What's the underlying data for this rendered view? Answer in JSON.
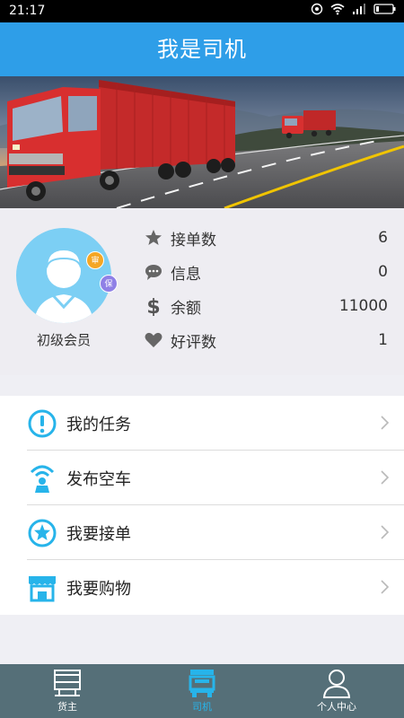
{
  "status_bar": {
    "time": "21:17"
  },
  "header": {
    "title": "我是司机"
  },
  "profile": {
    "member_level": "初级会员",
    "badges": [
      {
        "text": "审",
        "color": "#f5a623"
      },
      {
        "text": "保",
        "color": "#8f80e6"
      }
    ],
    "stats": [
      {
        "icon": "star-icon",
        "label": "接单数",
        "value": "6"
      },
      {
        "icon": "message-icon",
        "label": "信息",
        "value": "0"
      },
      {
        "icon": "dollar-icon",
        "label": "余额",
        "value": "11000"
      },
      {
        "icon": "heart-icon",
        "label": "好评数",
        "value": "1"
      }
    ]
  },
  "menu": [
    {
      "icon": "exclamation-icon",
      "label": "我的任务"
    },
    {
      "icon": "truck-signal-icon",
      "label": "发布空车"
    },
    {
      "icon": "star-circle-icon",
      "label": "我要接单"
    },
    {
      "icon": "shop-icon",
      "label": "我要购物"
    }
  ],
  "tabbar": {
    "tabs": [
      {
        "icon": "cargo-icon",
        "label": "货主",
        "active": false
      },
      {
        "icon": "truck-icon",
        "label": "司机",
        "active": true
      },
      {
        "icon": "person-icon",
        "label": "个人中心",
        "active": false
      }
    ]
  },
  "colors": {
    "header_bg": "#2e9ee8",
    "accent": "#27b4ea",
    "tabbar_bg": "#556f78",
    "avatar_bg": "#7ccff4"
  }
}
